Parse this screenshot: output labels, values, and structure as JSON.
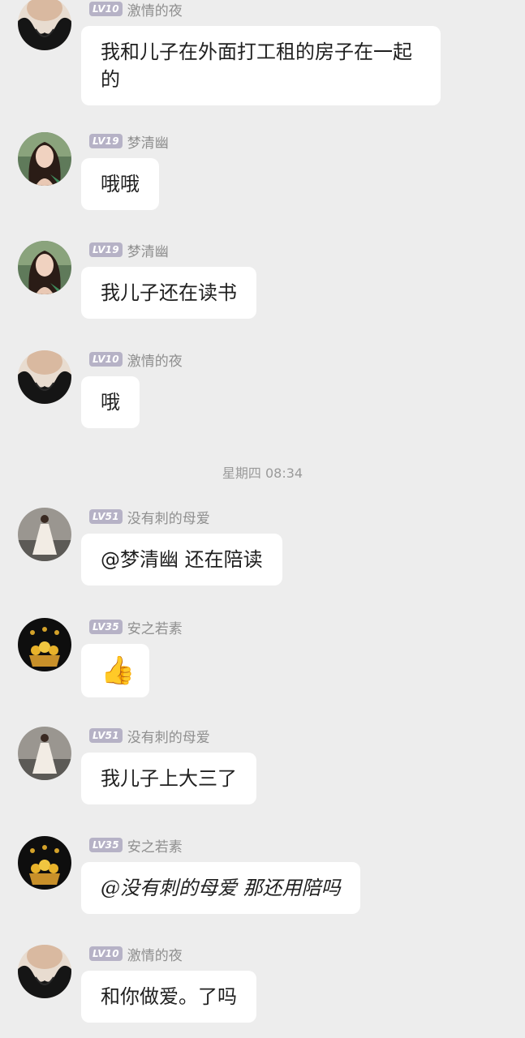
{
  "messages": [
    {
      "level": "LV10",
      "nickname": "激情的夜",
      "text": "我和儿子在外面打工租的房子在一起的",
      "avatar": "avatar-dark-outfit"
    },
    {
      "level": "LV19",
      "nickname": "梦清幽",
      "text": "哦哦",
      "avatar": "avatar-woman-portrait"
    },
    {
      "level": "LV19",
      "nickname": "梦清幽",
      "text": "我儿子还在读书",
      "avatar": "avatar-woman-portrait"
    },
    {
      "level": "LV10",
      "nickname": "激情的夜",
      "text": "哦",
      "avatar": "avatar-dark-outfit"
    },
    {
      "level": "LV51",
      "nickname": "没有刺的母爱",
      "text": "@梦清幽 还在陪读",
      "avatar": "avatar-woman-white-dress"
    },
    {
      "level": "LV35",
      "nickname": "安之若素",
      "text": "👍",
      "avatar": "avatar-flower-basket",
      "is_emoji": true
    },
    {
      "level": "LV51",
      "nickname": "没有刺的母爱",
      "text": "我儿子上大三了",
      "avatar": "avatar-woman-white-dress"
    },
    {
      "level": "LV35",
      "nickname": "安之若素",
      "text": "@没有刺的母爱 那还用陪吗",
      "avatar": "avatar-flower-basket"
    },
    {
      "level": "LV10",
      "nickname": "激情的夜",
      "text": "和你做爱。了吗",
      "avatar": "avatar-dark-outfit"
    }
  ],
  "timestamp": "星期四 08:34",
  "colors": {
    "background": "#ededed",
    "bubble": "#ffffff",
    "level_badge": "#b6b2c6",
    "nickname": "#8f8f8f",
    "timestamp": "#9a9a9a"
  }
}
